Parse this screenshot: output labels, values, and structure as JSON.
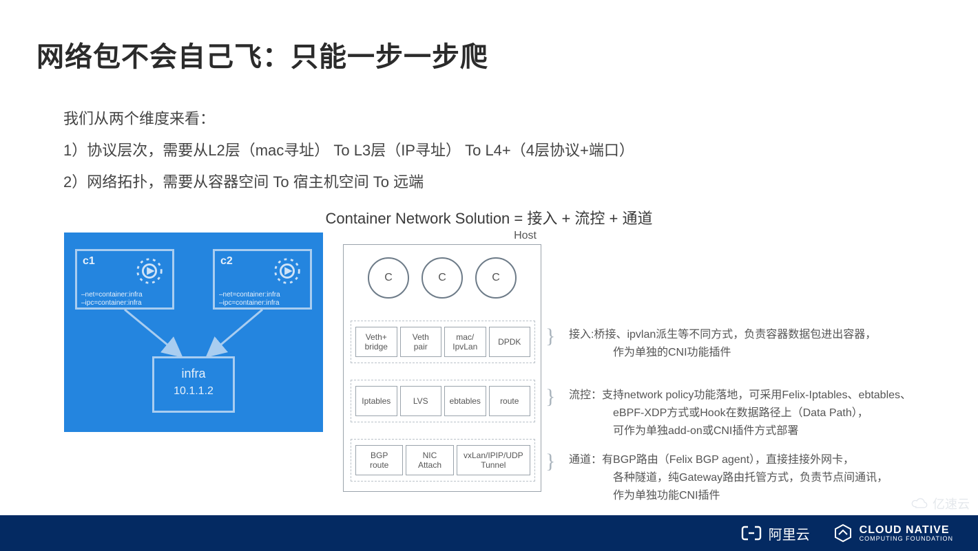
{
  "title": "网络包不会自己飞：只能一步一步爬",
  "intro": {
    "l1": "我们从两个维度来看：",
    "l2": "1）协议层次，需要从L2层（mac寻址） To   L3层（IP寻址） To  L4+（4层协议+端口）",
    "l3": "2）网络拓扑，需要从容器空间  To  宿主机空间  To 远端"
  },
  "equation": "Container Network Solution = 接入 + 流控 + 通道",
  "left": {
    "c1": {
      "name": "c1",
      "cfg1": "–net=container:infra",
      "cfg2": "–ipc=container:infra"
    },
    "c2": {
      "name": "c2",
      "cfg1": "–net=container:infra",
      "cfg2": "–ipc=container:infra"
    },
    "infra": {
      "name": "infra",
      "ip": "10.1.1.2"
    }
  },
  "host": {
    "label": "Host",
    "circle": "C",
    "row1": [
      "Veth+\nbridge",
      "Veth\npair",
      "mac/\nIpvLan",
      "DPDK"
    ],
    "row2": [
      "Iptables",
      "LVS",
      "ebtables",
      "route"
    ],
    "row3": [
      "BGP\nroute",
      "NIC\nAttach",
      "vxLan/IPIP/UDP\nTunnel"
    ]
  },
  "notes": {
    "n1": {
      "label": "接入:",
      "l1": "桥接、ipvlan派生等不同方式，负责容器数据包进出容器，",
      "l2": "作为单独的CNI功能插件"
    },
    "n2": {
      "label": "流控：",
      "l1": "支持network policy功能落地，可采用Felix-Iptables、ebtables、",
      "l2": "eBPF-XDP方式或Hook在数据路径上（Data Path），",
      "l3": "可作为单独add-on或CNI插件方式部署"
    },
    "n3": {
      "label": "通道：",
      "l1": "有BGP路由（Felix BGP agent），直接挂接外网卡，",
      "l2": " 各种隧道，纯Gateway路由托管方式，负责节点间通讯，",
      "l3": "作为单独功能CNI插件"
    }
  },
  "footer": {
    "ali": "阿里云",
    "cn_big": "CLOUD NATIVE",
    "cn_small": "COMPUTING FOUNDATION"
  },
  "watermark": "亿速云"
}
